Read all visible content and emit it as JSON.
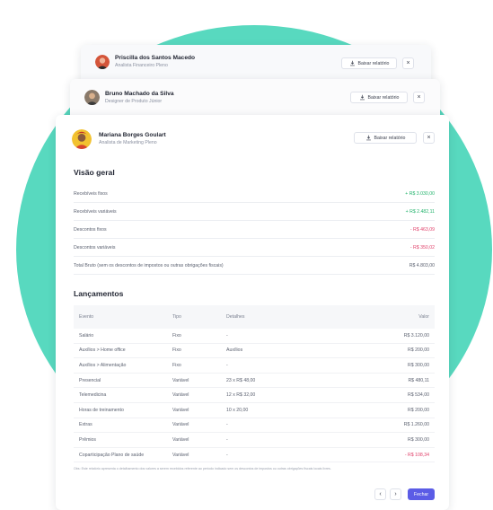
{
  "cards": [
    {
      "name": "Priscilla dos Santos Macedo",
      "role": "Analista Financeiro Pleno",
      "download_label": "Baixar relatório",
      "close_symbol": "×"
    },
    {
      "name": "Bruno Machado da Silva",
      "role": "Designer de Produto Júnior",
      "download_label": "Baixar relatório",
      "close_symbol": "×"
    },
    {
      "name": "Mariana Borges Goulart",
      "role": "Analista de Marketing Pleno",
      "download_label": "Baixar relatório",
      "close_symbol": "×"
    }
  ],
  "overview": {
    "title": "Visão geral",
    "rows": [
      {
        "label": "Recebíveis fixos",
        "value": "+ R$ 3.030,00",
        "tone": "pos"
      },
      {
        "label": "Recebíveis variáveis",
        "value": "+ R$ 2.482,11",
        "tone": "pos"
      },
      {
        "label": "Descontos fixos",
        "value": "- R$ 463,09",
        "tone": "neg"
      },
      {
        "label": "Descontos variáveis",
        "value": "- R$ 350,02",
        "tone": "neg"
      },
      {
        "label": "Total Bruto (sem os descontos de impostos ou outras obrigações fiscais)",
        "value": "R$ 4.803,00",
        "tone": "plain"
      }
    ]
  },
  "entries": {
    "title": "Lançamentos",
    "headers": [
      "Evento",
      "Tipo",
      "Detalhes",
      "Valor"
    ],
    "rows": [
      [
        "Salário",
        "Fixo",
        "-",
        "R$ 3.120,00"
      ],
      [
        "Auxílios > Home office",
        "Fixo",
        "Auxílios",
        "R$ 200,00"
      ],
      [
        "Auxílios > Alimentação",
        "Fixo",
        "-",
        "R$ 300,00"
      ],
      [
        "Presencial",
        "Variável",
        "23 x R$ 48,00",
        "R$ 480,11"
      ],
      [
        "Telemedicina",
        "Variável",
        "12 x R$ 32,00",
        "R$ 534,00"
      ],
      [
        "Horas de treinamento",
        "Variável",
        "10 x 20,00",
        "R$ 200,00"
      ],
      [
        "Extras",
        "Variável",
        "-",
        "R$ 1.260,00"
      ],
      [
        "Prêmios",
        "Variável",
        "-",
        "R$ 300,00"
      ],
      [
        "Coparticipação Plano de saúde",
        "Variável",
        "-",
        "- R$ 108,34"
      ]
    ],
    "value_tones": [
      "plain",
      "plain",
      "plain",
      "plain",
      "plain",
      "plain",
      "plain",
      "plain",
      "neg"
    ]
  },
  "footnote": "Obs: Este relatório apresenta o detalhamento dos valores a serem recebidos referente ao período indicado sem os descontos de impostos ou outras obrigações fiscais locais livres.",
  "pagination": {
    "prev_symbol": "‹",
    "next_symbol": "›"
  },
  "close_label": "Fechar"
}
